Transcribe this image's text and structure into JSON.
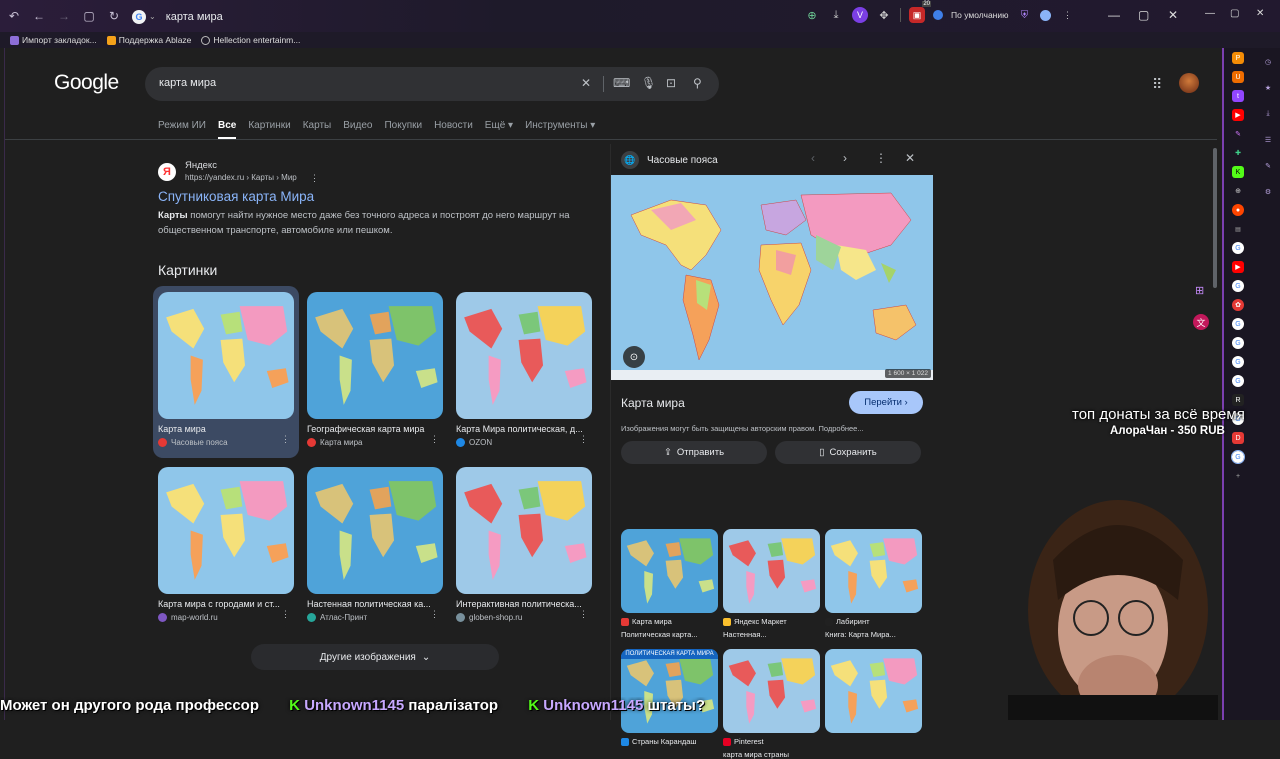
{
  "browser": {
    "url": "карта мира",
    "profile_label": "По умолчанию",
    "ext_badge": "20"
  },
  "bookmarks": [
    "Импорт закладок...",
    "Поддержка Ablaze",
    "Hellection entertainm..."
  ],
  "google": {
    "logo": "Google",
    "query": "карта мира",
    "tabs": [
      "Режим ИИ",
      "Все",
      "Картинки",
      "Карты",
      "Видео",
      "Покупки",
      "Новости",
      "Ещё ▾",
      "Инструменты ▾"
    ],
    "active_tab": "Все"
  },
  "result": {
    "site": "Яндекс",
    "crumb": "https://yandex.ru › Карты › Мир",
    "title": "Спутниковая карта Мира",
    "snippet_bold": "Карты",
    "snippet": " помогут найти нужное место даже без точного адреса и построят до него маршрут на общественном транспорте, автомобиле или пешком."
  },
  "images": {
    "heading": "Картинки",
    "items": [
      {
        "caption": "Карта мира",
        "source": "Часовые пояса",
        "color": "#e53935"
      },
      {
        "caption": "Географическая карта мира",
        "source": "Карта мира",
        "color": "#e53935"
      },
      {
        "caption": "Карта Мира политическая, д...",
        "source": "OZON",
        "color": "#1e88e5"
      },
      {
        "caption": "Карта мира с городами и ст...",
        "source": "map-world.ru",
        "color": "#7e57c2"
      },
      {
        "caption": "Настенная политическая ка...",
        "source": "Атлас-Принт",
        "color": "#26a69a"
      },
      {
        "caption": "Интерактивная политическа...",
        "source": "globen-shop.ru",
        "color": "#78909c"
      }
    ],
    "more": "Другие изображения"
  },
  "panel": {
    "header": "Часовые пояса",
    "dimensions": "1 600 × 1 022",
    "title": "Карта мира",
    "go": "Перейти",
    "copyright": "Изображения могут быть защищены авторским правом. Подробнее...",
    "share": "Отправить",
    "save": "Сохранить",
    "related": [
      {
        "source": "Карта мира",
        "title": "Политическая карта...",
        "color": "#e53935"
      },
      {
        "source": "Яндекс Маркет",
        "title": "Настенная...",
        "color": "#fbc02d"
      },
      {
        "source": "Лабиринт",
        "title": "Книга: Карта Мира...",
        "color": "#212121"
      },
      {
        "source": "Страны Карандаш",
        "title": "",
        "color": "#1e88e5"
      },
      {
        "source": "Pinterest",
        "title": "карта мира страны",
        "color": "#e60023"
      },
      {
        "source": "",
        "title": "",
        "color": "#888888"
      }
    ],
    "related_banner": "ПОЛИТИЧЕСКАЯ КАРТА МИРА"
  },
  "stream": {
    "donation_title": "топ донаты за всё время",
    "donation_top": "АлораЧан - 350 RUB",
    "chat": [
      {
        "text": "Может он другого рода профессор",
        "user": ""
      },
      {
        "text": "паралізатор",
        "user": "Unknown1145"
      },
      {
        "text": "штаты?",
        "user": "Unknown1145"
      }
    ]
  }
}
